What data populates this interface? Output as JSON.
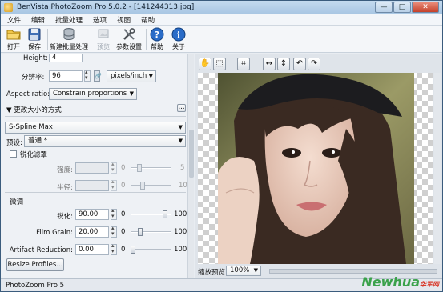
{
  "window": {
    "title": "BenVista PhotoZoom Pro 5.0.2 - [141244313.jpg]",
    "minimize": "—",
    "maximize": "□",
    "close": "✕"
  },
  "menu": [
    "文件",
    "编辑",
    "批量处理",
    "选项",
    "视图",
    "帮助"
  ],
  "toolbar": {
    "open": "打开",
    "save": "保存",
    "batch": "新建批量处理",
    "preview": "预览",
    "settings": "参数设置",
    "help": "帮助",
    "about": "关于"
  },
  "size": {
    "height_label": "Height:",
    "height_value": "4",
    "resolution_label": "分辨率:",
    "resolution_value": "96",
    "resolution_unit": "pixels/inch",
    "aspect_label": "Aspect ratio:",
    "aspect_value": "Constrain proportions"
  },
  "resize_method": {
    "header": "▼ 更改大小的方式",
    "header_btn": "...",
    "method": "S-Spline Max",
    "preset_label": "预设:",
    "preset_value": "普通 *",
    "sharpen_label": "锐化滤罩",
    "strength_label": "强度:",
    "strength_min": "0",
    "strength_max": "5",
    "radius_label": "半径:",
    "radius_min": "0",
    "radius_max": "10"
  },
  "finetune": {
    "header": "微调",
    "sharpness_label": "锐化:",
    "sharpness_value": "90.00",
    "sharpness_min": "0",
    "sharpness_max": "100",
    "sharpness_level": 0.9,
    "grain_label": "Film Grain:",
    "grain_value": "20.00",
    "grain_min": "0",
    "grain_max": "100",
    "grain_level": 0.2,
    "artifact_label": "Artifact Reduction:",
    "artifact_value": "0.00",
    "artifact_min": "0",
    "artifact_max": "100",
    "artifact_level": 0.0
  },
  "resize_profiles_btn": "Resize Profiles...",
  "preview_panel": {
    "zoom_label": "缩放预览:",
    "zoom_value": "100%"
  },
  "status": "PhotoZoom Pro 5",
  "watermark": "NewHua 华军网",
  "colors": {
    "title_bar": "#a8c6e3",
    "help_blue": "#1f5fbf",
    "watermark_green": "#3aa14a",
    "watermark_red": "#d93a2b"
  }
}
